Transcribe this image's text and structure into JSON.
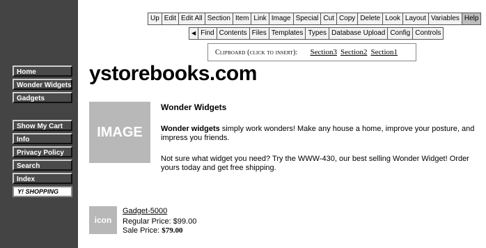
{
  "sidebar": {
    "nav_top": [
      "Home",
      "Wonder Widgets",
      "Gadgets"
    ],
    "nav_bottom": [
      "Show My Cart",
      "Info",
      "Privacy Policy",
      "Search",
      "Index"
    ],
    "badge": "Y! SHOPPING"
  },
  "toolbar1": [
    "Up",
    "Edit",
    "Edit All",
    "Section",
    "Item",
    "Link",
    "Image",
    "Special",
    "Cut",
    "Copy",
    "Delete",
    "Look",
    "Layout",
    "Variables",
    "Help"
  ],
  "toolbar2": [
    "Find",
    "Contents",
    "Files",
    "Templates",
    "Types",
    "Database Upload",
    "Config",
    "Controls"
  ],
  "clipboard": {
    "label": "Clipboard (click to insert):",
    "links": [
      "Section3",
      "Section2",
      "Section1"
    ]
  },
  "site_title": "ystorebooks.com",
  "main_image_text": "IMAGE",
  "section": {
    "heading": "Wonder Widgets",
    "para1_bold": "Wonder widgets",
    "para1_rest": " simply work wonders! Make any house a home, improve your posture, and impress you friends.",
    "para2": "Not sure what widget you need? Try the WWW-430, our best selling Wonder Widget! Order yours today and get free shipping."
  },
  "product": {
    "icon_text": "icon",
    "name": "Gadget-5000",
    "regular_label": "Regular Price: ",
    "regular_value": "$99.00",
    "sale_label": "Sale Price: ",
    "sale_value": "$79.00"
  }
}
